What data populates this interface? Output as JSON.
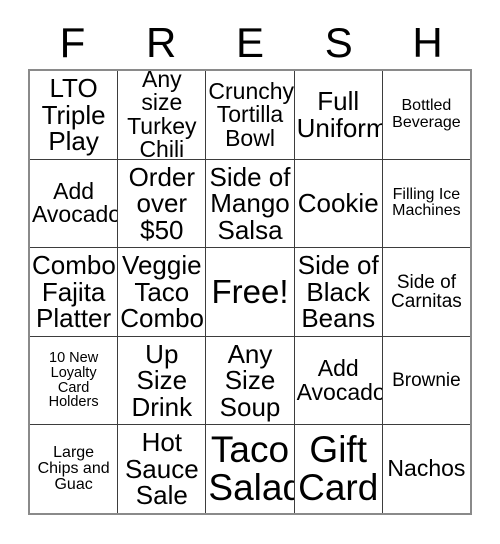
{
  "card": {
    "title_letters": [
      "F",
      "R",
      "E",
      "S",
      "H"
    ],
    "rows": [
      [
        {
          "text": "LTO\nTriple\nPlay",
          "size": "lg"
        },
        {
          "text": "Any size\nTurkey\nChili",
          "size": "md"
        },
        {
          "text": "Crunchy\nTortilla\nBowl",
          "size": "md"
        },
        {
          "text": "Full\nUniform",
          "size": "lg"
        },
        {
          "text": "Bottled\nBeverage",
          "size": "xs"
        }
      ],
      [
        {
          "text": "Add\nAvocado",
          "size": "md"
        },
        {
          "text": "Order\nover\n$50",
          "size": "lg"
        },
        {
          "text": "Side of\nMango\nSalsa",
          "size": "lg"
        },
        {
          "text": "Cookie",
          "size": "lg"
        },
        {
          "text": "Filling Ice\nMachines",
          "size": "xs"
        }
      ],
      [
        {
          "text": "Combo\nFajita\nPlatter",
          "size": "lg"
        },
        {
          "text": "Veggie\nTaco\nCombo",
          "size": "lg"
        },
        {
          "text": "Free!",
          "size": "xl"
        },
        {
          "text": "Side of\nBlack\nBeans",
          "size": "lg"
        },
        {
          "text": "Side of\nCarnitas",
          "size": "sm"
        }
      ],
      [
        {
          "text": "10 New\nLoyalty\nCard\nHolders",
          "size": "xxs"
        },
        {
          "text": "Up\nSize\nDrink",
          "size": "lg"
        },
        {
          "text": "Any\nSize\nSoup",
          "size": "lg"
        },
        {
          "text": "Add\nAvocado",
          "size": "md"
        },
        {
          "text": "Brownie",
          "size": "sm"
        }
      ],
      [
        {
          "text": "Large\nChips and\nGuac",
          "size": "xs"
        },
        {
          "text": "Hot\nSauce\nSale",
          "size": "lg"
        },
        {
          "text": "Taco\nSalad",
          "size": "xxl"
        },
        {
          "text": "Gift\nCard",
          "size": "xxl"
        },
        {
          "text": "Nachos",
          "size": "md"
        }
      ]
    ]
  },
  "colors": {
    "background": "#ffffff",
    "text": "#000000",
    "grid_line": "#3d3d3d",
    "grid_border": "#8a8a8a"
  }
}
